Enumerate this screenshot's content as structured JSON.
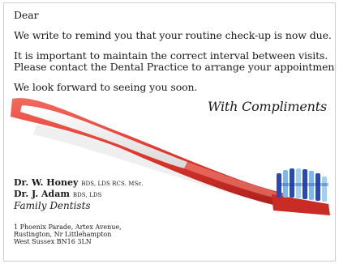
{
  "letter": {
    "greeting": "Dear",
    "line1": "We write to remind you that your routine check-up is now due.",
    "line2": "It is important to maintain the correct interval between visits.",
    "line3": "Please contact the Dental Practice to arrange your appointment.",
    "line4": "We look forward to seeing you soon.",
    "compliments": "With Compliments"
  },
  "dentists": [
    {
      "name": "Dr. W. Honey",
      "quals": "BDS, LDS RCS. MSc."
    },
    {
      "name": "Dr. J. Adam",
      "quals": "BDS, LDS"
    }
  ],
  "practice": "Family Dentists",
  "address": [
    "1 Phoenix Parade, Artex Avenue,",
    "Rustington, Nr Littlehampton",
    "West Sussex BN16 3LN"
  ],
  "illustration": {
    "icon": "toothbrush-icon",
    "handle_color": "#e0382f",
    "grip_color": "#f1f1f1",
    "bristle_color": "#2a49b8"
  }
}
